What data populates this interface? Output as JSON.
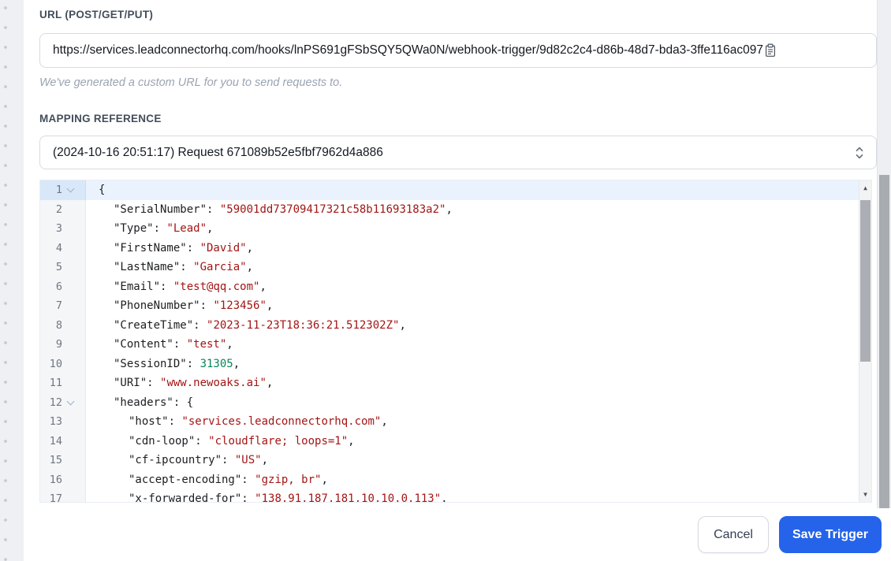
{
  "url_section": {
    "label": "URL (POST/GET/PUT)",
    "value": "https://services.leadconnectorhq.com/hooks/lnPS691gFSbSQY5QWa0N/webhook-trigger/9d82c2c4-d86b-48d7-bda3-3ffe116ac097",
    "helper": "We've generated a custom URL for you to send requests to."
  },
  "mapping_section": {
    "label": "MAPPING REFERENCE",
    "selected_option": "(2024-10-16 20:51:17) Request 671089b52e5fbf7962d4a886"
  },
  "editor": {
    "language": "json",
    "active_line": 1,
    "lines": [
      {
        "num": "1",
        "fold": true,
        "active": true,
        "indent": 0,
        "tokens": [
          [
            "{",
            "p"
          ]
        ]
      },
      {
        "num": "2",
        "indent": 1,
        "tokens": [
          [
            "\"SerialNumber\"",
            "k"
          ],
          [
            ": ",
            "p"
          ],
          [
            "\"59001dd73709417321c58b11693183a2\"",
            "s"
          ],
          [
            ",",
            "p"
          ]
        ]
      },
      {
        "num": "3",
        "indent": 1,
        "tokens": [
          [
            "\"Type\"",
            "k"
          ],
          [
            ": ",
            "p"
          ],
          [
            "\"Lead\"",
            "s"
          ],
          [
            ",",
            "p"
          ]
        ]
      },
      {
        "num": "4",
        "indent": 1,
        "tokens": [
          [
            "\"FirstName\"",
            "k"
          ],
          [
            ": ",
            "p"
          ],
          [
            "\"David\"",
            "s"
          ],
          [
            ",",
            "p"
          ]
        ]
      },
      {
        "num": "5",
        "indent": 1,
        "tokens": [
          [
            "\"LastName\"",
            "k"
          ],
          [
            ": ",
            "p"
          ],
          [
            "\"Garcia\"",
            "s"
          ],
          [
            ",",
            "p"
          ]
        ]
      },
      {
        "num": "6",
        "indent": 1,
        "tokens": [
          [
            "\"Email\"",
            "k"
          ],
          [
            ": ",
            "p"
          ],
          [
            "\"test@qq.com\"",
            "s"
          ],
          [
            ",",
            "p"
          ]
        ]
      },
      {
        "num": "7",
        "indent": 1,
        "tokens": [
          [
            "\"PhoneNumber\"",
            "k"
          ],
          [
            ": ",
            "p"
          ],
          [
            "\"123456\"",
            "s"
          ],
          [
            ",",
            "p"
          ]
        ]
      },
      {
        "num": "8",
        "indent": 1,
        "tokens": [
          [
            "\"CreateTime\"",
            "k"
          ],
          [
            ": ",
            "p"
          ],
          [
            "\"2023-11-23T18:36:21.512302Z\"",
            "s"
          ],
          [
            ",",
            "p"
          ]
        ]
      },
      {
        "num": "9",
        "indent": 1,
        "tokens": [
          [
            "\"Content\"",
            "k"
          ],
          [
            ": ",
            "p"
          ],
          [
            "\"test\"",
            "s"
          ],
          [
            ",",
            "p"
          ]
        ]
      },
      {
        "num": "10",
        "indent": 1,
        "tokens": [
          [
            "\"SessionID\"",
            "k"
          ],
          [
            ": ",
            "p"
          ],
          [
            "31305",
            "n"
          ],
          [
            ",",
            "p"
          ]
        ]
      },
      {
        "num": "11",
        "indent": 1,
        "tokens": [
          [
            "\"URI\"",
            "k"
          ],
          [
            ": ",
            "p"
          ],
          [
            "\"www.newoaks.ai\"",
            "s"
          ],
          [
            ",",
            "p"
          ]
        ]
      },
      {
        "num": "12",
        "fold": true,
        "indent": 1,
        "tokens": [
          [
            "\"headers\"",
            "k"
          ],
          [
            ": {",
            "p"
          ]
        ]
      },
      {
        "num": "13",
        "indent": 2,
        "tokens": [
          [
            "\"host\"",
            "k"
          ],
          [
            ": ",
            "p"
          ],
          [
            "\"services.leadconnectorhq.com\"",
            "s"
          ],
          [
            ",",
            "p"
          ]
        ]
      },
      {
        "num": "14",
        "indent": 2,
        "tokens": [
          [
            "\"cdn-loop\"",
            "k"
          ],
          [
            ": ",
            "p"
          ],
          [
            "\"cloudflare; loops=1\"",
            "s"
          ],
          [
            ",",
            "p"
          ]
        ]
      },
      {
        "num": "15",
        "indent": 2,
        "tokens": [
          [
            "\"cf-ipcountry\"",
            "k"
          ],
          [
            ": ",
            "p"
          ],
          [
            "\"US\"",
            "s"
          ],
          [
            ",",
            "p"
          ]
        ]
      },
      {
        "num": "16",
        "indent": 2,
        "tokens": [
          [
            "\"accept-encoding\"",
            "k"
          ],
          [
            ": ",
            "p"
          ],
          [
            "\"gzip, br\"",
            "s"
          ],
          [
            ",",
            "p"
          ]
        ]
      },
      {
        "num": "17",
        "indent": 2,
        "tokens": [
          [
            "\"x-forwarded-for\"",
            "k"
          ],
          [
            ": ",
            "p"
          ],
          [
            "\"138.91.187.181,10.10.0.113\"",
            "s"
          ],
          [
            ",",
            "p"
          ]
        ]
      }
    ]
  },
  "footer": {
    "cancel": "Cancel",
    "save": "Save Trigger"
  },
  "icons": {
    "scroll_up": "▲",
    "scroll_down": "▼"
  },
  "colors": {
    "accent_blue": "#2563eb",
    "string_red": "#a31515",
    "number_green": "#098658",
    "active_line_blue": "#eaf3fd",
    "canvas_gray": "#eef0f3"
  }
}
